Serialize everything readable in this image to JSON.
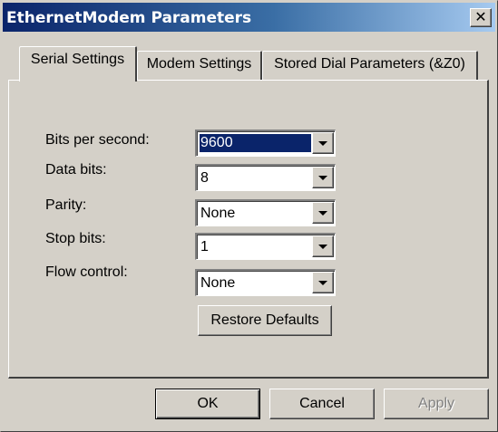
{
  "window": {
    "title": "EthernetModem Parameters"
  },
  "tabs": [
    {
      "label": "Serial Settings",
      "active": true
    },
    {
      "label": "Modem Settings",
      "active": false
    },
    {
      "label": "Stored Dial Parameters (&Z0)",
      "active": false
    }
  ],
  "fields": {
    "bits_per_second": {
      "label": "Bits per second:",
      "value": "9600"
    },
    "data_bits": {
      "label": "Data bits:",
      "value": "8"
    },
    "parity": {
      "label": "Parity:",
      "value": "None"
    },
    "stop_bits": {
      "label": "Stop bits:",
      "value": "1"
    },
    "flow_control": {
      "label": "Flow control:",
      "value": "None"
    }
  },
  "restore_label": "Restore Defaults",
  "buttons": {
    "ok": "OK",
    "cancel": "Cancel",
    "apply": "Apply"
  },
  "icons": {
    "close": "close-icon",
    "dropdown": "chevron-down-icon"
  },
  "colors": {
    "title_start": "#0a246a",
    "title_end": "#a6caf0",
    "face": "#d4d0c8",
    "selection": "#0a246a"
  }
}
